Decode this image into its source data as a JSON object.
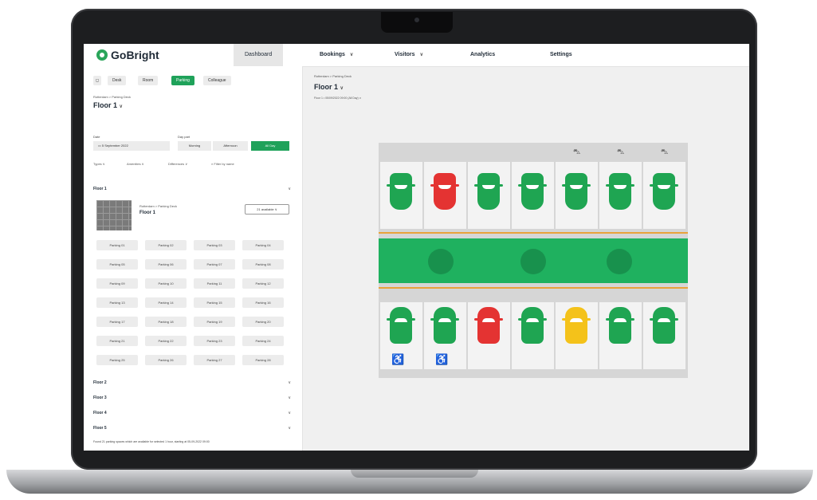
{
  "app": {
    "name": "GoBright"
  },
  "nav": {
    "items": [
      {
        "label": "Dashboard",
        "caret": false,
        "active": true
      },
      {
        "label": "Bookings",
        "caret": true,
        "active": false
      },
      {
        "label": "Visitors",
        "caret": true,
        "active": false
      },
      {
        "label": "Analytics",
        "caret": false,
        "active": false
      },
      {
        "label": "Settings",
        "caret": false,
        "active": false
      }
    ]
  },
  "left": {
    "type_chips": [
      "Desk",
      "Room",
      "Parking",
      "Colleague"
    ],
    "active_chip": "Parking",
    "breadcrumb": "Rotterdam > Parking Deck",
    "floor_title": "Floor 1",
    "date_label": "Date",
    "date_value": "5 September 2022",
    "daypart_label": "Day part",
    "dayparts": [
      "Morning",
      "Afternoon",
      "All Day"
    ],
    "active_daypart": "All Day",
    "filters": [
      "Types",
      "Amenities",
      "Differences",
      "Filter by name"
    ],
    "section_floor1": "Floor 1",
    "floor_card": {
      "breadcrumb": "Rotterdam > Parking Deck",
      "title": "Floor 1",
      "available": "21 available"
    },
    "spots": [
      "Parking 01",
      "Parking 02",
      "Parking 03",
      "Parking 04",
      "Parking 05",
      "Parking 06",
      "Parking 07",
      "Parking 08",
      "Parking 09",
      "Parking 10",
      "Parking 11",
      "Parking 12",
      "Parking 13",
      "Parking 14",
      "Parking 15",
      "Parking 16",
      "Parking 17",
      "Parking 18",
      "Parking 19",
      "Parking 20",
      "Parking 21",
      "Parking 22",
      "Parking 23",
      "Parking 24",
      "Parking 25",
      "Parking 26",
      "Parking 27",
      "Parking 28"
    ],
    "other_floors": [
      "Floor 2",
      "Floor 3",
      "Floor 4",
      "Floor 5"
    ],
    "footnote": "Found 21 parking spaces which are available for selected 1 hour, starting at 05-09-2022 09:00"
  },
  "right": {
    "breadcrumb": "Rotterdam > Parking Deck",
    "floor_title": "Floor 1",
    "plan_select": "Floor 1 • 05/09/2022 09:00 (All Day)"
  },
  "map": {
    "colors": {
      "available": "#1fa552",
      "occupied": "#e43332",
      "reserved": "#f4c21a"
    },
    "top_row": [
      "available",
      "occupied",
      "available",
      "available",
      "available",
      "available",
      "available"
    ],
    "bottom_row": [
      "available",
      "available",
      "occupied",
      "available",
      "reserved",
      "available",
      "available"
    ],
    "top_icons": [
      "car-icon",
      "car-icon",
      "car-icon"
    ],
    "bottom_icons": [
      "wheelchair-icon",
      "wheelchair-icon"
    ]
  }
}
